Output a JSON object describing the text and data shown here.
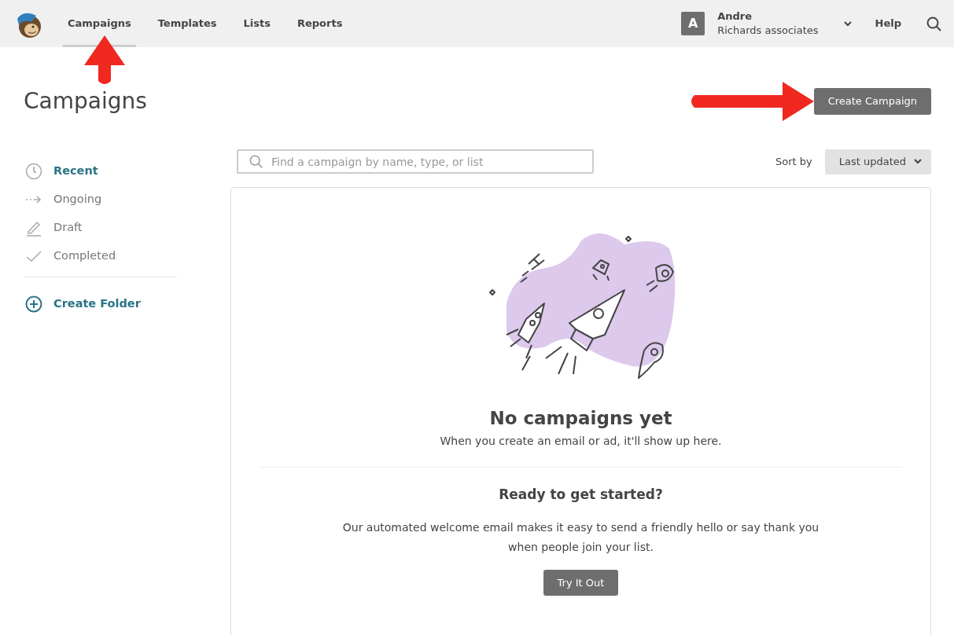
{
  "nav": {
    "links": [
      {
        "label": "Campaigns",
        "selected": true
      },
      {
        "label": "Templates",
        "selected": false
      },
      {
        "label": "Lists",
        "selected": false
      },
      {
        "label": "Reports",
        "selected": false
      }
    ],
    "account": {
      "initial": "A",
      "name": "Andre",
      "org": "Richards associates"
    },
    "help": "Help"
  },
  "page_title": "Campaigns",
  "create_button": "Create Campaign",
  "sidebar": {
    "items": [
      {
        "label": "Recent",
        "selected": true
      },
      {
        "label": "Ongoing",
        "selected": false
      },
      {
        "label": "Draft",
        "selected": false
      },
      {
        "label": "Completed",
        "selected": false
      }
    ],
    "create_folder": "Create Folder"
  },
  "search": {
    "placeholder": "Find a campaign by name, type, or list"
  },
  "sort": {
    "label": "Sort by",
    "value": "Last updated"
  },
  "empty_state": {
    "title": "No campaigns yet",
    "text": "When you create an email or ad, it'll show up here.",
    "prompt_title": "Ready to get started?",
    "prompt_text": "Our automated welcome email makes it easy to send a friendly hello or say thank you when people join your list.",
    "button": "Try It Out"
  }
}
